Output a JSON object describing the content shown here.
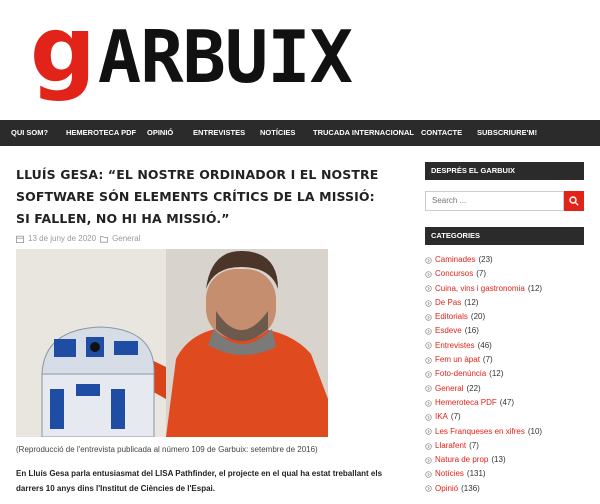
{
  "logo": {
    "first_letter": "g",
    "rest": "ARBUIX"
  },
  "nav": {
    "items": [
      {
        "label": "QUI SOM?"
      },
      {
        "label": "HEMEROTECA PDF"
      },
      {
        "label": "OPINIÓ"
      },
      {
        "label": "ENTREVISTES"
      },
      {
        "label": "NOTÍCIES"
      },
      {
        "label": "TRUCADA INTERNACIONAL"
      },
      {
        "label": "CONTACTE"
      },
      {
        "label": "SUBSCRIURE'M!"
      }
    ]
  },
  "article": {
    "title": "Lluís Gesa: “El nostre ordinador i el nostre software són elements crítics de la missió: si fallen, no hi ha missió.”",
    "date": "13 de juny de 2020",
    "category": "General",
    "caption": "(Reproducció de l'entrevista publicada al número 109 de Garbuix: setembre de 2016)",
    "lead": "En Lluís Gesa parla entusiasmat del LISA Pathfinder, el projecte en el qual ha estat treballant els darrers 10 anys dins l'Institut de Ciències de l'Espai."
  },
  "sidebar": {
    "follow_title": "DESPRÉS EL GARBUIX",
    "search_placeholder": "Search ...",
    "categories_title": "CATEGORIES",
    "categories": [
      {
        "name": "Caminades",
        "count": "(23)"
      },
      {
        "name": "Concursos",
        "count": "(7)"
      },
      {
        "name": "Cuina, vins i gastronomia",
        "count": "(12)"
      },
      {
        "name": "De Pas",
        "count": "(12)"
      },
      {
        "name": "Editorials",
        "count": "(20)"
      },
      {
        "name": "Esdeve",
        "count": "(16)"
      },
      {
        "name": "Entrevistes",
        "count": "(46)"
      },
      {
        "name": "Fem un àpat",
        "count": "(7)"
      },
      {
        "name": "Foto-denúncia",
        "count": "(12)"
      },
      {
        "name": "General",
        "count": "(22)"
      },
      {
        "name": "Hemeroteca PDF",
        "count": "(47)"
      },
      {
        "name": "IKA",
        "count": "(7)"
      },
      {
        "name": "Les Franqueses en xifres",
        "count": "(10)"
      },
      {
        "name": "Llarafent",
        "count": "(7)"
      },
      {
        "name": "Natura de prop",
        "count": "(13)"
      },
      {
        "name": "Notícies",
        "count": "(131)"
      },
      {
        "name": "Opinió",
        "count": "(136)"
      }
    ]
  },
  "colors": {
    "brand_red": "#e2231a",
    "nav_bg": "#2b2b2b"
  }
}
